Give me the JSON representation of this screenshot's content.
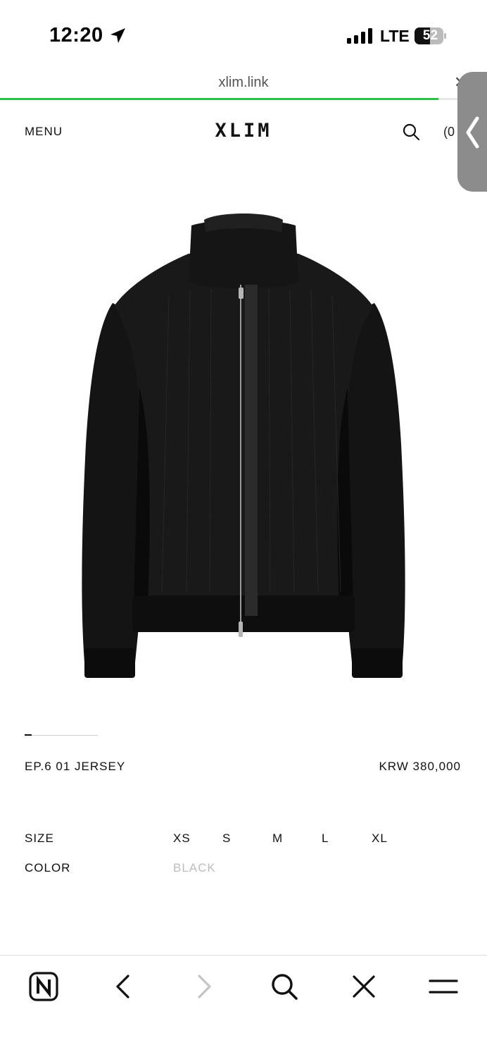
{
  "status_bar": {
    "time": "12:20",
    "network": "LTE",
    "battery_level": "52"
  },
  "browser": {
    "url": "xlim.link",
    "load_progress_pct": 90
  },
  "site_header": {
    "menu_label": "MENU",
    "logo": "XLIM",
    "cart_count": "(0"
  },
  "product": {
    "name": "EP.6 01 JERSEY",
    "price": "KRW 380,000",
    "image_icon": "black-zip-jacket-image",
    "size_label": "SIZE",
    "sizes": [
      "XS",
      "S",
      "M",
      "L",
      "XL"
    ],
    "color_label": "COLOR",
    "color_value": "BLACK"
  },
  "toolbar": {
    "buttons": [
      "naver-home-icon",
      "back-icon",
      "forward-icon",
      "search-icon",
      "close-icon",
      "menu-icon"
    ]
  },
  "colors": {
    "progress": "#2fc04a",
    "disabled_text": "#bdbdbd",
    "side_handle": "#8c8c8c"
  }
}
